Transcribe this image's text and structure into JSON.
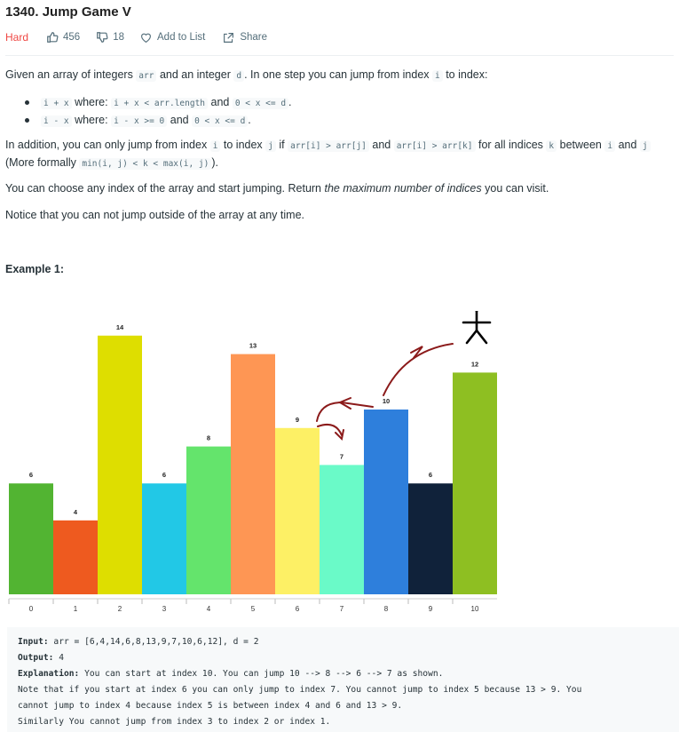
{
  "header": {
    "title": "1340. Jump Game V",
    "difficulty": "Hard",
    "likes": "456",
    "dislikes": "18",
    "add_to_list": "Add to List",
    "share": "Share"
  },
  "description": {
    "p1_a": "Given an array of integers ",
    "p1_code1": "arr",
    "p1_b": " and an integer ",
    "p1_code2": "d",
    "p1_c": ". In one step you can jump from index ",
    "p1_code3": "i",
    "p1_d": " to index:",
    "b1_code1": "i + x",
    "b1_a": " where: ",
    "b1_code2": "i + x < arr.length",
    "b1_b": " and ",
    "b1_code3": "0 < x <= d",
    "b1_c": ".",
    "b2_code1": "i - x",
    "b2_a": " where: ",
    "b2_code2": "i - x >= 0",
    "b2_b": " and ",
    "b2_code3": "0 < x <= d",
    "b2_c": ".",
    "p2_a": "In addition, you can only jump from index ",
    "p2_code1": "i",
    "p2_b": " to index ",
    "p2_code2": "j",
    "p2_c": " if ",
    "p2_code3": "arr[i] > arr[j]",
    "p2_d": " and ",
    "p2_code4": "arr[i] > arr[k]",
    "p2_e": " for all indices ",
    "p2_code5": "k",
    "p2_f": " between ",
    "p2_code6": "i",
    "p2_g": " and ",
    "p2_code7": "j",
    "p2_h": " (More formally ",
    "p2_code8": "min(i, j) < k < max(i, j)",
    "p2_i": ").",
    "p3_a": "You can choose any index of the array and start jumping. Return ",
    "p3_em": "the maximum number of indices",
    "p3_b": " you can visit.",
    "p4": "Notice that you can not jump outside of the array at any time."
  },
  "example": {
    "title": "Example 1:",
    "input_label": "Input:",
    "input_value": " arr = [6,4,14,6,8,13,9,7,10,6,12], d = 2",
    "output_label": "Output:",
    "output_value": " 4",
    "explanation_label": "Explanation:",
    "explanation_1": " You can start at index 10. You can jump 10 --> 8 --> 6 --> 7 as shown.",
    "explanation_2": "Note that if you start at index 6 you can only jump to index 7. You cannot jump to index 5 because 13 > 9. You",
    "explanation_3": "cannot jump to index 4 because index 5 is between index 4 and 6 and 13 > 9.",
    "explanation_4": "Similarly You cannot jump from index 3 to index 2 or index 1."
  },
  "colors": {
    "hard": "#ef4743",
    "arrow": "#8b1a1a"
  },
  "chart_data": {
    "type": "bar",
    "categories": [
      "0",
      "1",
      "2",
      "3",
      "4",
      "5",
      "6",
      "7",
      "8",
      "9",
      "10"
    ],
    "values": [
      6,
      4,
      14,
      6,
      8,
      13,
      9,
      7,
      10,
      6,
      12
    ],
    "bar_colors": [
      "#52b432",
      "#ee5a1f",
      "#dede00",
      "#22c8e6",
      "#64e46c",
      "#fe9654",
      "#fdf065",
      "#6afac8",
      "#2e7fdc",
      "#10223a",
      "#8ebf22"
    ],
    "title": "",
    "xlabel": "",
    "ylabel": "",
    "ylim": [
      0,
      14
    ],
    "grid": false,
    "jump_path": [
      10,
      8,
      6,
      7
    ]
  }
}
